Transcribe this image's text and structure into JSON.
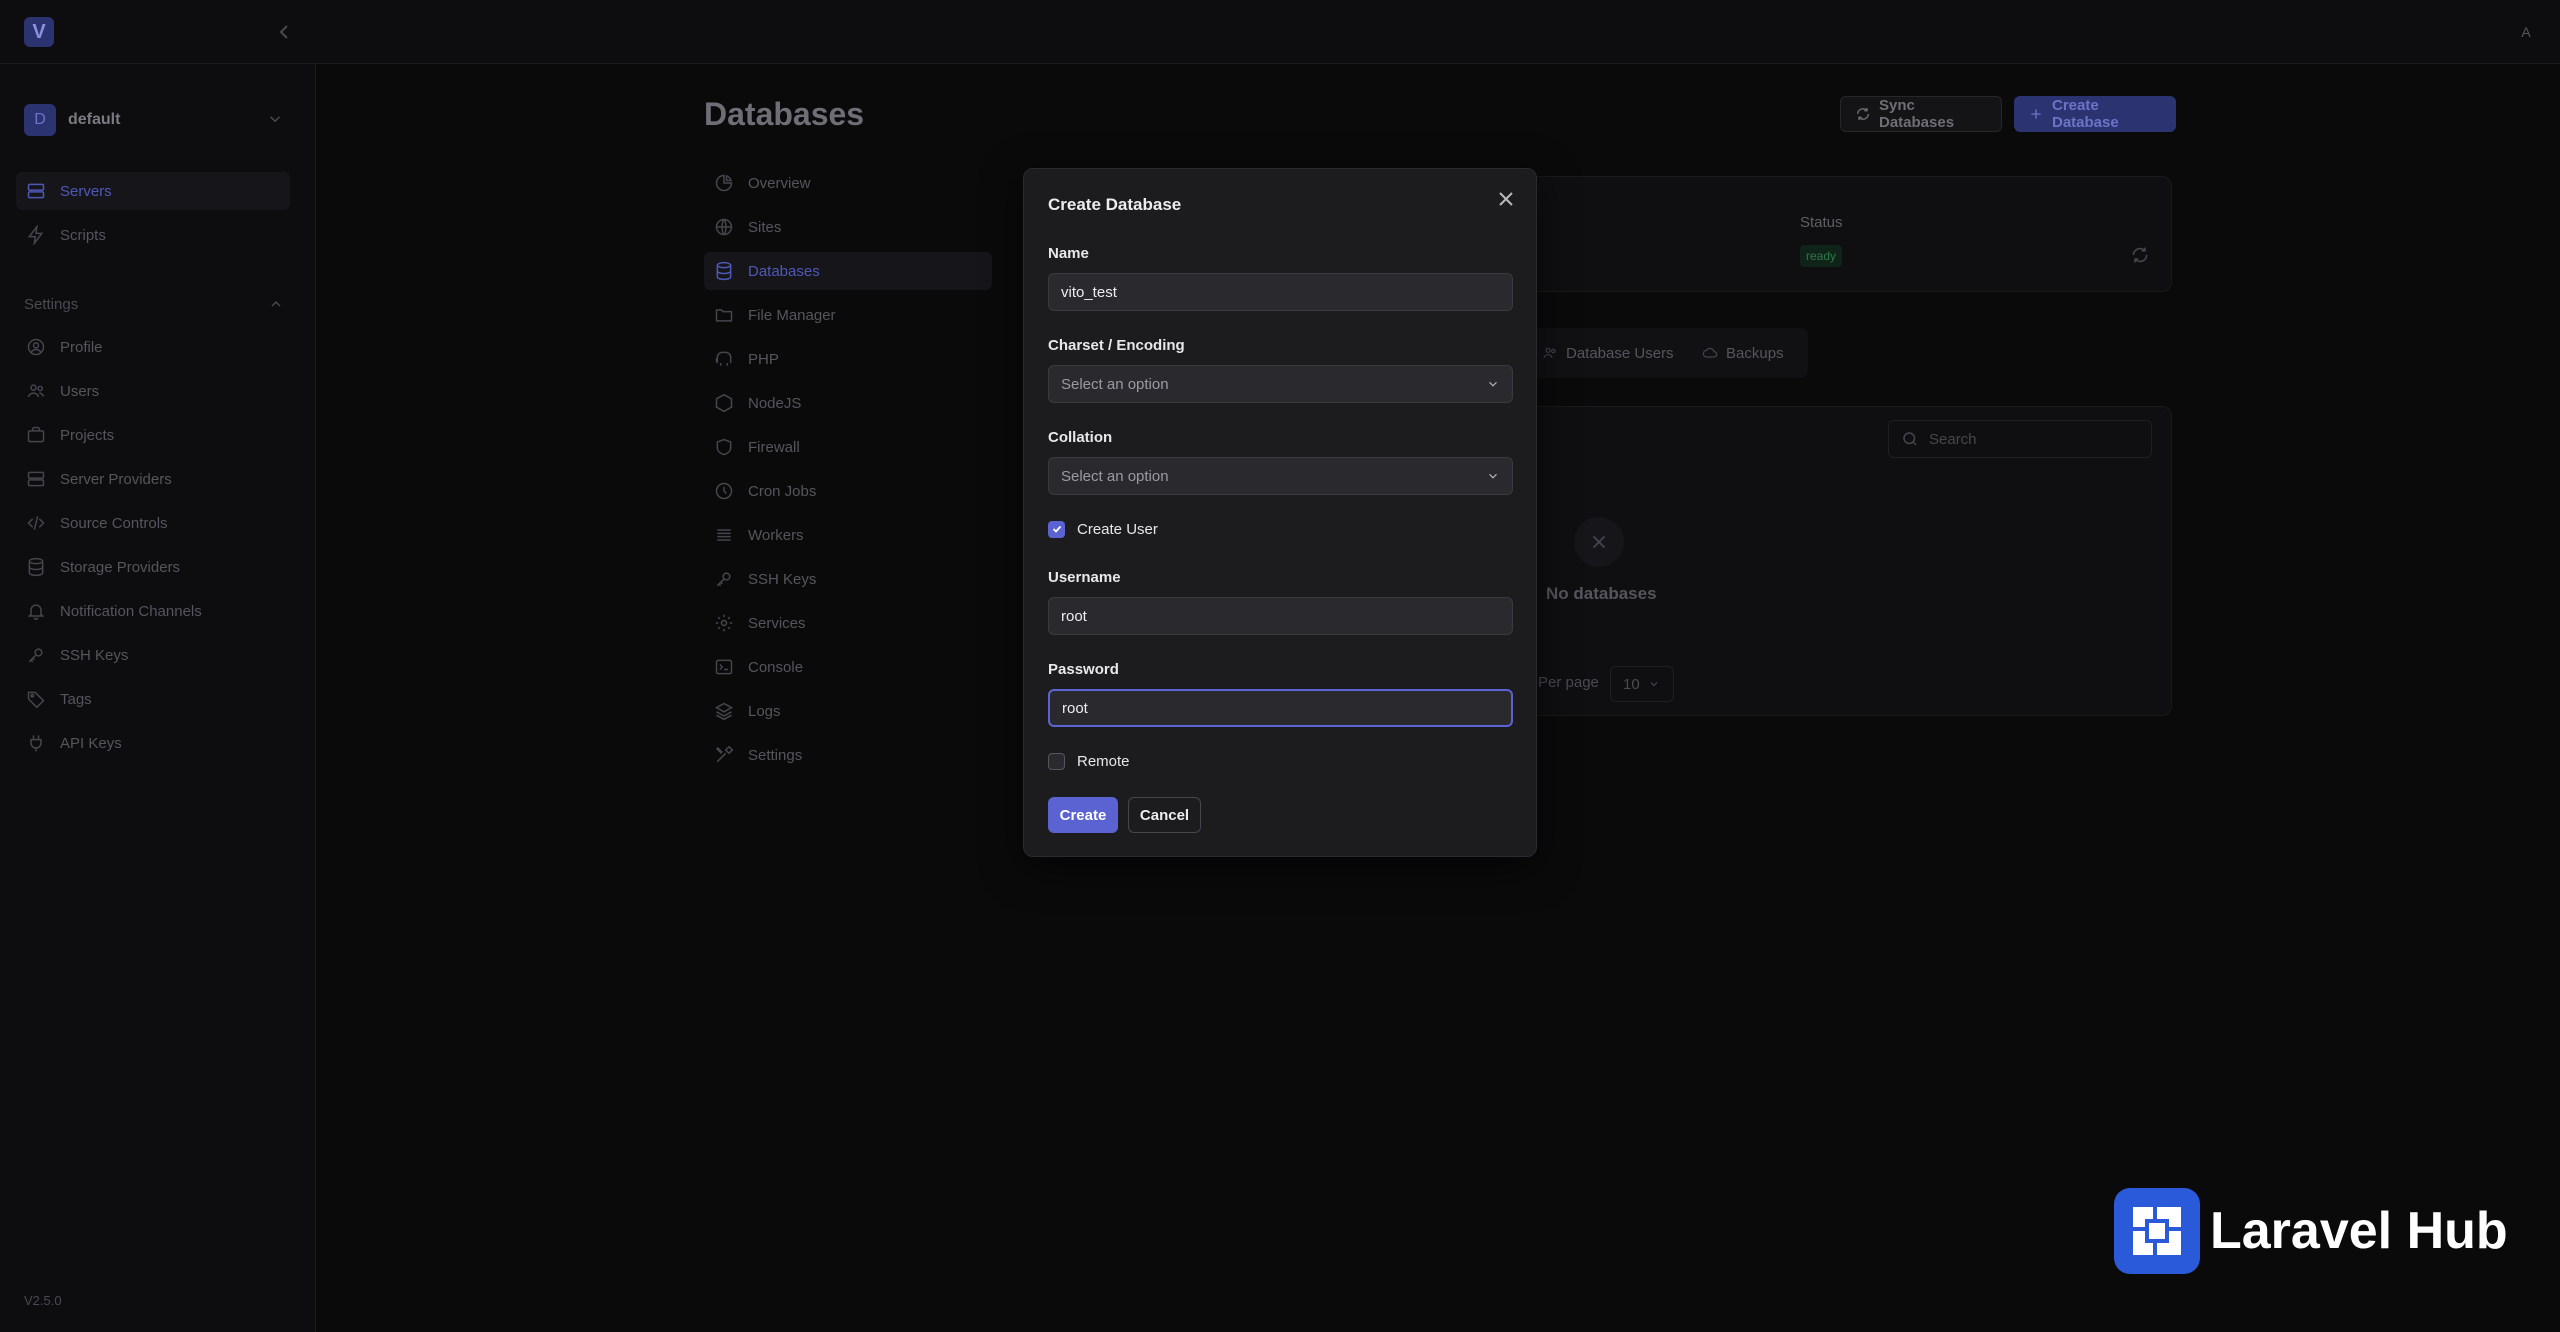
{
  "app": {
    "logo_letter": "V",
    "user_initial": "A",
    "version": "V2.5.0"
  },
  "project": {
    "initial": "D",
    "name": "default"
  },
  "sidebar": {
    "main_items": [
      {
        "label": "Servers",
        "icon": "server-icon",
        "active": true
      },
      {
        "label": "Scripts",
        "icon": "bolt-icon",
        "active": false
      }
    ],
    "settings_title": "Settings",
    "settings_items": [
      {
        "label": "Profile",
        "icon": "user-circle-icon"
      },
      {
        "label": "Users",
        "icon": "users-icon"
      },
      {
        "label": "Projects",
        "icon": "briefcase-icon"
      },
      {
        "label": "Server Providers",
        "icon": "server-stack-icon"
      },
      {
        "label": "Source Controls",
        "icon": "code-icon"
      },
      {
        "label": "Storage Providers",
        "icon": "database-icon"
      },
      {
        "label": "Notification Channels",
        "icon": "bell-icon"
      },
      {
        "label": "SSH Keys",
        "icon": "key-icon"
      },
      {
        "label": "Tags",
        "icon": "tag-icon"
      },
      {
        "label": "API Keys",
        "icon": "plug-icon"
      }
    ]
  },
  "page": {
    "title": "Databases",
    "sync_label": "Sync Databases",
    "create_label": "Create Database"
  },
  "server_nav": [
    {
      "label": "Overview",
      "icon": "gauge-icon",
      "active": false
    },
    {
      "label": "Sites",
      "icon": "globe-icon",
      "active": false
    },
    {
      "label": "Databases",
      "icon": "database-icon",
      "active": true
    },
    {
      "label": "File Manager",
      "icon": "folder-icon",
      "active": false
    },
    {
      "label": "PHP",
      "icon": "elephant-icon",
      "active": false
    },
    {
      "label": "NodeJS",
      "icon": "hexagon-icon",
      "active": false
    },
    {
      "label": "Firewall",
      "icon": "shield-icon",
      "active": false
    },
    {
      "label": "Cron Jobs",
      "icon": "clock-icon",
      "active": false
    },
    {
      "label": "Workers",
      "icon": "list-icon",
      "active": false
    },
    {
      "label": "SSH Keys",
      "icon": "key-icon",
      "active": false
    },
    {
      "label": "Services",
      "icon": "cog-icon",
      "active": false
    },
    {
      "label": "Console",
      "icon": "terminal-icon",
      "active": false
    },
    {
      "label": "Logs",
      "icon": "layers-icon",
      "active": false
    },
    {
      "label": "Settings",
      "icon": "tools-icon",
      "active": false
    }
  ],
  "server_card": {
    "status_label": "Status",
    "status_value": "ready"
  },
  "tabs": [
    {
      "label": "Database Users",
      "icon": "users-icon"
    },
    {
      "label": "Backups",
      "icon": "cloud-icon"
    }
  ],
  "table": {
    "search_placeholder": "Search",
    "empty_text": "No databases",
    "per_page_label": "Per page",
    "per_page_value": "10"
  },
  "watermark": {
    "text": "Laravel Hub"
  },
  "modal": {
    "title": "Create Database",
    "name_label": "Name",
    "name_value": "vito_test",
    "charset_label": "Charset / Encoding",
    "charset_placeholder": "Select an option",
    "collation_label": "Collation",
    "collation_placeholder": "Select an option",
    "create_user_label": "Create User",
    "create_user_checked": true,
    "username_label": "Username",
    "username_value": "root",
    "password_label": "Password",
    "password_value": "root",
    "remote_label": "Remote",
    "remote_checked": false,
    "create_button": "Create",
    "cancel_button": "Cancel"
  }
}
